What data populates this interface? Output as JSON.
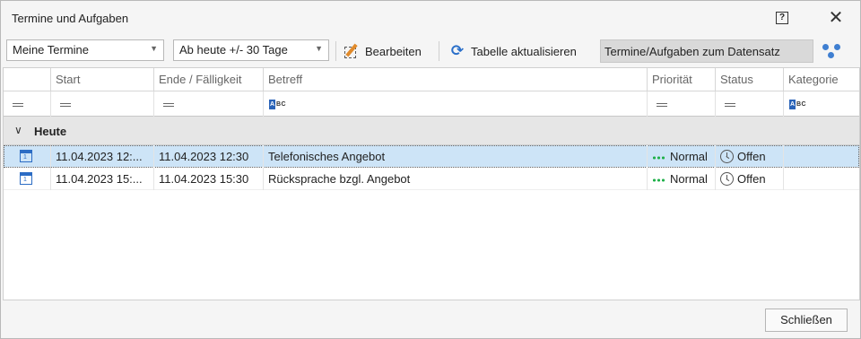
{
  "window": {
    "title": "Termine und Aufgaben",
    "help_glyph": "?",
    "close_glyph": "✕"
  },
  "toolbar": {
    "filter_combo": "Meine Termine",
    "range_combo": "Ab heute +/- 30 Tage",
    "edit_label": "Bearbeiten",
    "refresh_label": "Tabelle aktualisieren",
    "record_label": "Termine/Aufgaben zum Datensatz"
  },
  "columns": [
    "Start",
    "Ende / Fälligkeit",
    "Betreff",
    "Priorität",
    "Status",
    "Kategorie"
  ],
  "group": {
    "label": "Heute"
  },
  "rows": [
    {
      "start": "11.04.2023 12:...",
      "end": "11.04.2023 12:30",
      "subject": "Telefonisches Angebot",
      "priority": "Normal",
      "status": "Offen",
      "category": "",
      "selected": true
    },
    {
      "start": "11.04.2023 15:...",
      "end": "11.04.2023 15:30",
      "subject": "Rücksprache bzgl. Angebot",
      "priority": "Normal",
      "status": "Offen",
      "category": "",
      "selected": false
    }
  ],
  "footer": {
    "close_label": "Schließen"
  },
  "colors": {
    "selection": "#cde4f7",
    "priority_dots": "#22b14c",
    "accent": "#2b6cc4"
  },
  "icons": {
    "row_type": "calendar-icon",
    "priority": "priority-dots-icon",
    "status": "clock-icon",
    "edit": "edit-icon",
    "refresh": "refresh-icon",
    "group_by": "group-icon"
  }
}
